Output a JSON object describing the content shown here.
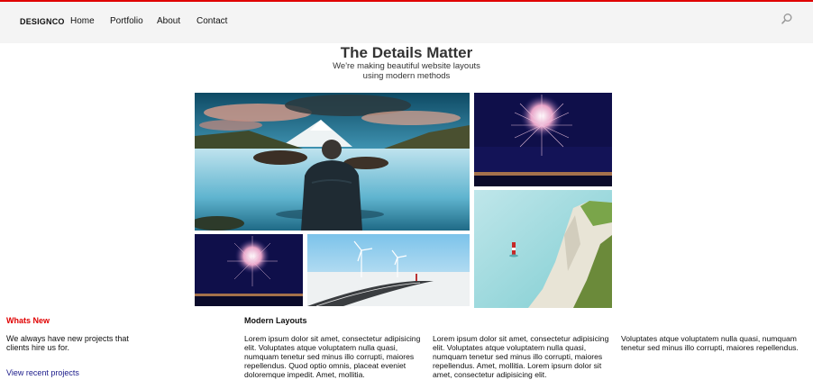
{
  "nav": {
    "brand": "DESIGNCO",
    "links": [
      "Home",
      "Portfolio",
      "About",
      "Contact"
    ],
    "accent_color": "#e00000",
    "search_icon": "search-icon"
  },
  "hero": {
    "title": "The Details Matter",
    "subtitle_line1": "We're making beautiful website layouts",
    "subtitle_line2": "using modern methods"
  },
  "gallery": [
    "person-at-mountain-lake-photo",
    "fireworks-photo",
    "coastal-cliff-lighthouse-photo",
    "fireworks-photo",
    "wind-turbines-road-photo"
  ],
  "sidebar": {
    "heading": "Whats New",
    "text": "We always have new projects that clients hire us for.",
    "link": "View recent projects"
  },
  "content": {
    "heading": "Modern Layouts",
    "col1": "Lorem ipsum dolor sit amet, consectetur adipisicing elit. Voluptates atque voluptatem nulla quasi, numquam tenetur sed minus illo corrupti, maiores repellendus. Quod optio omnis, placeat eveniet doloremque impedit. Amet, mollitia.",
    "col2": "Lorem ipsum dolor sit amet, consectetur adipisicing elit. Voluptates atque voluptatem nulla quasi, numquam tenetur sed minus illo corrupti, maiores repellendus. Amet, mollitia. Lorem ipsum dolor sit amet, consectetur adipisicing elit.",
    "col3": "Voluptates atque voluptatem nulla quasi, numquam tenetur sed minus illo corrupti, maiores repellendus."
  }
}
